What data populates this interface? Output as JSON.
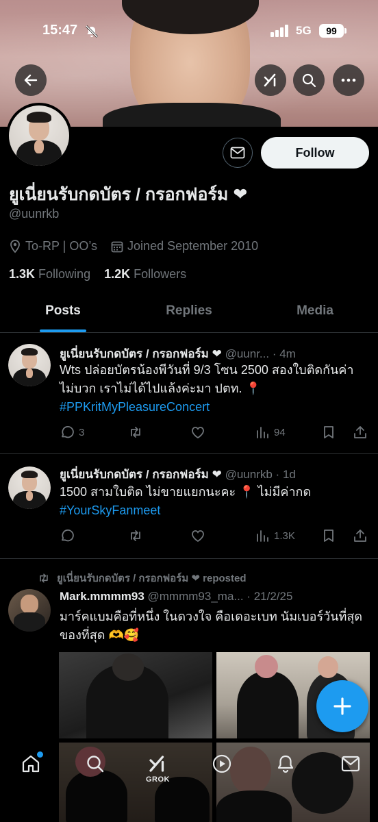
{
  "status_bar": {
    "time": "15:47",
    "network": "5G",
    "battery": "99"
  },
  "profile": {
    "display_name": "ยูเนี่ยนรับกดบัตร / กรอกฟอร์ม ❤",
    "handle": "@uunrkb",
    "location": "To-RP | OO’s",
    "joined": "Joined September 2010",
    "following_count": "1.3K",
    "following_label": "Following",
    "followers_count": "1.2K",
    "followers_label": "Followers",
    "follow_label": "Follow"
  },
  "tabs": [
    {
      "label": "Posts",
      "active": true
    },
    {
      "label": "Replies",
      "active": false
    },
    {
      "label": "Media",
      "active": false
    }
  ],
  "tweets": [
    {
      "name": "ยูเนี่ยนรับกดบัตร / กรอกฟอร์ม ❤",
      "handle": "@uunr...",
      "time": "4m",
      "text": "Wts ปล่อยบัตรน้องพีวันที่ 9/3 โซน 2500 สองใบติดกันค่า ไม่บวก เราไม่ได้ไปแล้งค่ะมา ปตท. 📍",
      "hashtag": "#PPKritMyPleasureConcert",
      "replies": "3",
      "retweets": "",
      "likes": "",
      "views": "94"
    },
    {
      "name": "ยูเนี่ยนรับกดบัตร / กรอกฟอร์ม ❤",
      "handle": "@uunrkb",
      "time": "1d",
      "text": "1500 สามใบติด ไม่ขายแยกนะคะ 📍 ไม่มีค่ากด",
      "hashtag": "#YourSkyFanmeet",
      "replies": "",
      "retweets": "",
      "likes": "",
      "views": "1.3K"
    },
    {
      "repost_label": "ยูเนี่ยนรับกดบัตร / กรอกฟอร์ม ❤ reposted",
      "name": "Mark.mmmm93",
      "handle": "@mmmm93_ma...",
      "time": "21/2/25",
      "text": "มาร์คแบมคือที่หนึ่ง ในดวงใจ คือเดอะเบท นัมเบอร์วันที่สุดของที่สุด 🫶🥰"
    }
  ],
  "bottom_nav": {
    "grok_label": "GROK"
  },
  "colors": {
    "accent": "#1d9bf0",
    "background": "#000000",
    "muted": "#71767b"
  }
}
